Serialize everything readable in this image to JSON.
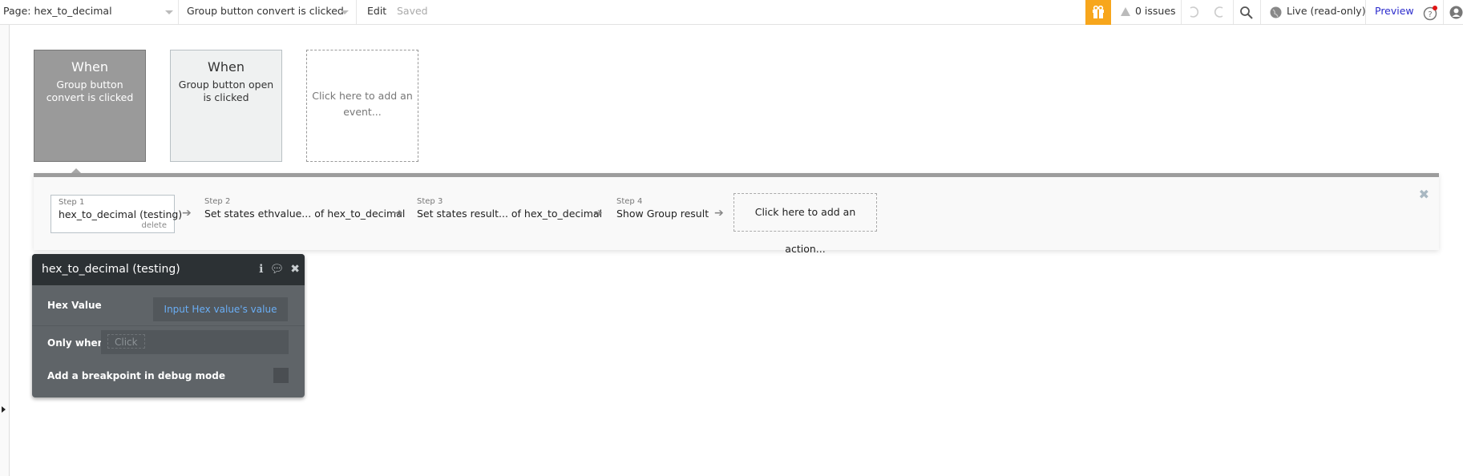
{
  "topbar": {
    "page_selector": "Page: hex_to_decimal",
    "event_selector": "Group button convert is clicked",
    "edit_label": "Edit",
    "saved_label": "Saved",
    "issues_label": "0 issues",
    "live_label": "Live (read-only)",
    "preview_label": "Preview",
    "accent_color": "#f7a61c",
    "icons": [
      "gift-icon",
      "warning-icon",
      "undo-icon",
      "redo-icon",
      "search-icon",
      "globe-icon",
      "help-icon",
      "user-icon"
    ]
  },
  "events": [
    {
      "when": "When",
      "desc": "Group button convert is clicked",
      "selected": true
    },
    {
      "when": "When",
      "desc": "Group button open is clicked",
      "selected": false
    }
  ],
  "add_event_label": "Click here to add an event...",
  "workflow": {
    "steps": [
      {
        "label": "Step 1",
        "name": "hex_to_decimal (testing)",
        "delete": "delete"
      },
      {
        "label": "Step 2",
        "name": "Set states ethvalue... of hex_to_decimal"
      },
      {
        "label": "Step 3",
        "name": "Set states result... of hex_to_decimal"
      },
      {
        "label": "Step 4",
        "name": "Show Group result"
      }
    ],
    "add_action_label": "Click here to add an action..."
  },
  "editor": {
    "title": "hex_to_decimal (testing)",
    "hex_value_label": "Hex Value",
    "hex_value": "Input Hex value's value",
    "only_when_label": "Only when",
    "only_when_placeholder": "Click",
    "breakpoint_label": "Add a breakpoint in debug mode",
    "breakpoint_checked": false
  }
}
